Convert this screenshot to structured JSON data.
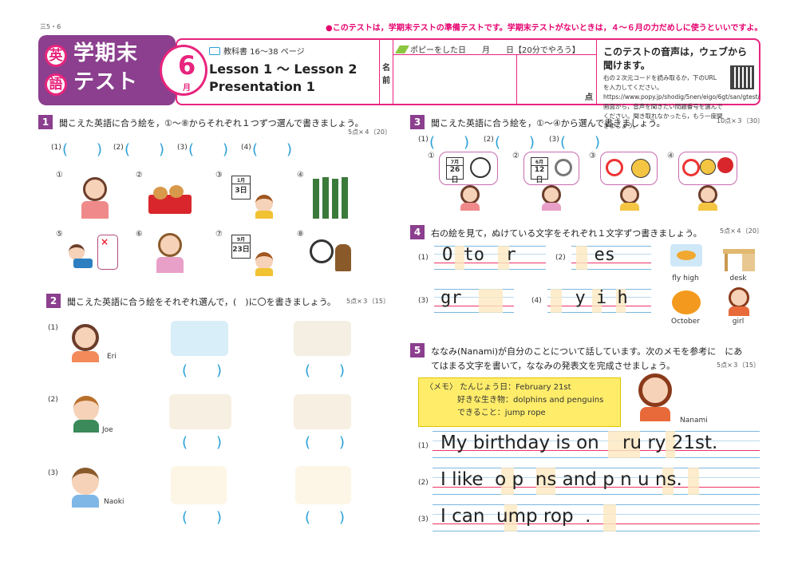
{
  "page_code": "三5・6",
  "top_note": "●このテストは，学期末テストの準備テストです。学期末テストがないときは，４～６月の力だめしに使うといいですよ。",
  "header": {
    "subject_1": "英",
    "subject_2": "語",
    "title_1": "学期末",
    "title_2": "テスト",
    "month": "6",
    "month_unit": "月",
    "textbook": "教科書 16～38 ページ",
    "lesson_1": "Lesson 1 ～ Lesson 2",
    "lesson_2": "Presentation 1",
    "name_label": "名\n前",
    "date_line": "ポピーをした日　　月　　日【20分でやろう】",
    "score_label": "点",
    "audio_title": "このテストの音声は，ウェブから聞けます。",
    "audio_text": "右の２次元コードを読み取るか，下のURL を入力してください。https://www.popy.jp/shodig/5nen/eigo/6gt/san/gtest/ 画面から，音声を聞きたい問題番号を選んでください。聞き取れなかったら，もう一度聞きましょう。"
  },
  "sec1": {
    "num": "1",
    "text": "聞こえた英語に合う絵を，①～⑧からそれぞれ１つずつ選んで書きましょう。",
    "score": "5点×４〔20〕",
    "answers": [
      "(1)",
      "(2)",
      "(3)",
      "(4)"
    ],
    "paren": "(　　)",
    "nums": [
      "①",
      "②",
      "③",
      "④",
      "⑤",
      "⑥",
      "⑦",
      "⑧"
    ],
    "cal_3": {
      "month": "1月",
      "day": "3日"
    },
    "cal_7": {
      "month": "9月",
      "day": "23日"
    }
  },
  "sec2": {
    "num": "2",
    "text": "聞こえた英語に合う絵をそれぞれ選んで，(　)に〇を書きましょう。",
    "score": "5点×３〔15〕",
    "rows": [
      {
        "q": "(1)",
        "name": "Eri"
      },
      {
        "q": "(2)",
        "name": "Joe"
      },
      {
        "q": "(3)",
        "name": "Naoki"
      }
    ],
    "paren": "(　　)"
  },
  "sec3": {
    "num": "3",
    "text": "聞こえた英語に合う絵を，①～④から選んで書きましょう。",
    "score": "10点×３〔30〕",
    "answers": [
      "(1)",
      "(2)",
      "(3)"
    ],
    "paren": "(　　)",
    "nums": [
      "①",
      "②",
      "③",
      "④"
    ],
    "cal_1": {
      "month": "7月",
      "day": "26日"
    },
    "cal_2": {
      "month": "6月",
      "day": "12日"
    }
  },
  "sec4": {
    "num": "4",
    "text": "右の絵を見て，ぬけている文字をそれぞれ１文字ずつ書きましょう。",
    "score": "5点×４〔20〕",
    "items": [
      {
        "q": "(1)",
        "text": "O to  r"
      },
      {
        "q": "(2)",
        "text": "  es"
      },
      {
        "q": "(3)",
        "text": "gr   "
      },
      {
        "q": "(4)",
        "text": "  y i h"
      }
    ],
    "words": [
      "fly high",
      "desk",
      "October",
      "girl"
    ]
  },
  "sec5": {
    "num": "5",
    "text_1": "ななみ(Nanami)が自分のことについて話しています。次のメモを参考に　にあ",
    "text_2": "てはまる文字を書いて，ななみの発表文を完成させましょう。",
    "score": "5点×３〔15〕",
    "memo": [
      "〈メモ〉 たんじょう日：February 21st",
      "　　　　好きな生き物：dolphins and penguins",
      "　　　　できること：jump rope"
    ],
    "girl_name": "Nanami",
    "lines": [
      {
        "q": "(1)",
        "text": "My birthday is on    ru ry 21st."
      },
      {
        "q": "(2)",
        "text": "I like  o p  ns and p n u ns."
      },
      {
        "q": "(3)",
        "text": "I can  ump rop  ."
      }
    ]
  }
}
